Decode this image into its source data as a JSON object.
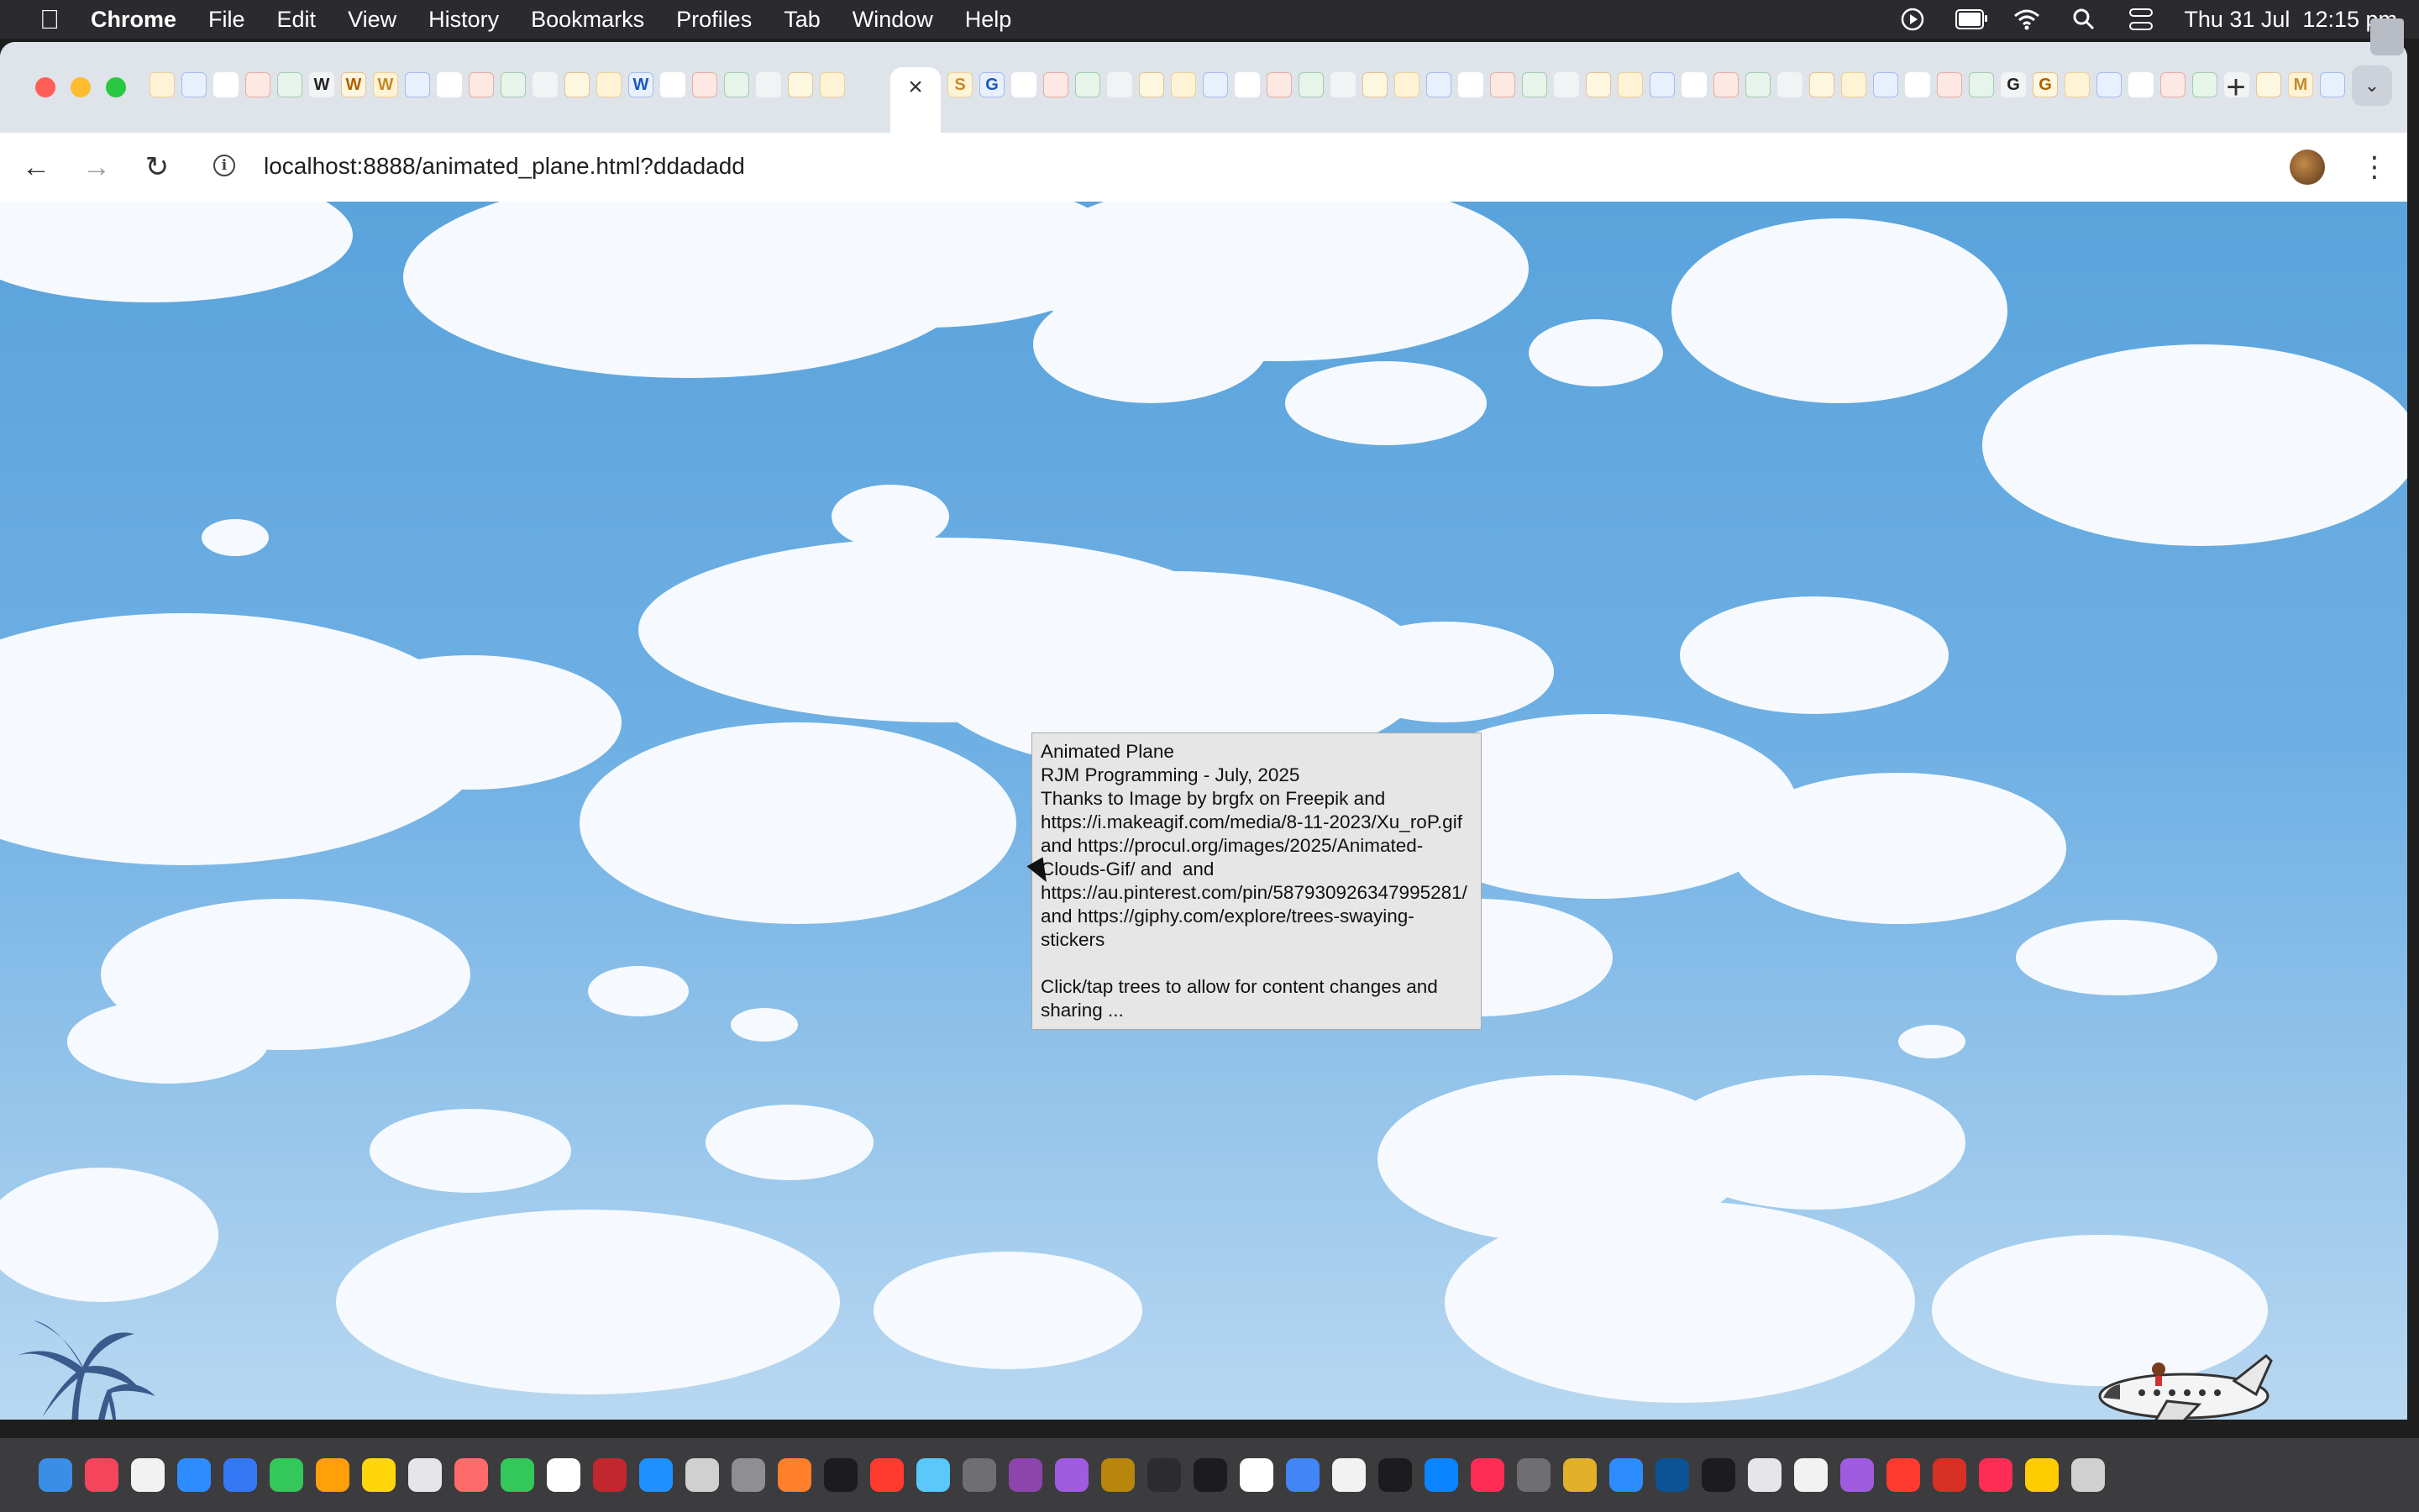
{
  "menubar": {
    "app": "Chrome",
    "items": [
      "File",
      "Edit",
      "View",
      "History",
      "Bookmarks",
      "Profiles",
      "Tab",
      "Window",
      "Help"
    ],
    "clock": "Thu 31 Jul  12:15 pm",
    "battery_level": 0.75
  },
  "browser": {
    "url": "localhost:8888/animated_plane.html?ddadadd",
    "active_tab_close": "×",
    "new_tab": "+",
    "favicon_letters_left": [
      "",
      "",
      "",
      "",
      "",
      "W",
      "W",
      "W",
      "",
      "",
      "",
      "",
      "",
      "",
      "",
      "W",
      "",
      "",
      "",
      "",
      "",
      ""
    ],
    "favicon_letters_right": [
      "S",
      "G",
      "",
      "",
      "",
      "",
      "",
      "",
      "",
      "",
      "",
      "",
      "",
      "",
      "",
      "",
      "",
      "",
      "",
      "",
      "",
      "",
      "",
      "",
      "",
      "",
      "",
      "",
      "",
      "",
      "",
      "",
      "",
      "G",
      "G",
      "",
      "",
      "",
      "",
      "",
      "",
      "",
      "M",
      "",
      ""
    ]
  },
  "page": {
    "tooltip_text": "Animated Plane\nRJM Programming - July, 2025\nThanks to Image by brgfx on Freepik and https://i.makeagif.com/media/8-11-2023/Xu_roP.gif and https://procul.org/images/2025/Animated-Clouds-Gif/ and  and https://au.pinterest.com/pin/587930926347995281/ and https://giphy.com/explore/trees-swaying-stickers\n\nClick/tap trees to allow for content changes and sharing ..."
  },
  "colors": {
    "sky_top": "#5aa3dc",
    "sky_bottom": "#b9d8f1",
    "tree": "#3a5a8c"
  }
}
